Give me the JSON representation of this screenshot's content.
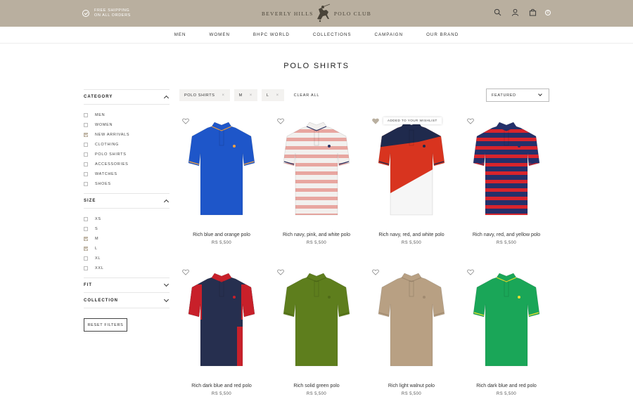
{
  "topbar": {
    "shipping_line1": "FREE SHIPPING",
    "shipping_line2": "ON ALL ORDERS",
    "logo_left": "BEVERLY HILLS",
    "logo_right": "POLO CLUB",
    "bag_count": "0",
    "bg_color": "#b9af9f"
  },
  "nav": {
    "items": [
      "MEN",
      "WOMEN",
      "BHPC WORLD",
      "COLLECTIONS",
      "CAMPAIGN",
      "OUR BRAND"
    ]
  },
  "page_title": "POLO SHIRTS",
  "sidebar": {
    "category": {
      "title": "CATEGORY",
      "options": [
        {
          "label": "MEN",
          "checked": false
        },
        {
          "label": "WOMEN",
          "checked": false
        },
        {
          "label": "NEW ARRIVALS",
          "checked": true
        },
        {
          "label": "CLOTHING",
          "checked": false
        },
        {
          "label": "POLO SHIRTS",
          "checked": false
        },
        {
          "label": "ACCESSORIES",
          "checked": false
        },
        {
          "label": "WATCHES",
          "checked": false
        },
        {
          "label": "SHOES",
          "checked": false
        }
      ]
    },
    "size": {
      "title": "SIZE",
      "options": [
        {
          "label": "XS",
          "checked": false
        },
        {
          "label": "S",
          "checked": false
        },
        {
          "label": "M",
          "checked": true
        },
        {
          "label": "L",
          "checked": true
        },
        {
          "label": "XL",
          "checked": false
        },
        {
          "label": "XXL",
          "checked": false
        }
      ]
    },
    "fit_title": "FIT",
    "collection_title": "COLLECTION",
    "reset_label": "RESET FILTERS"
  },
  "filters": {
    "chips": [
      "POLO SHIRTS",
      "M",
      "L"
    ],
    "clear_label": "CLEAR ALL",
    "sort_label": "FEATURED"
  },
  "wishlist_tooltip": "ADDED TO YOUR WISHLIST",
  "products": [
    {
      "name": "Rich blue and orange polo",
      "price": "RS 5,500",
      "style": "solid",
      "body": "#1e56c9",
      "collar": "#1e56c9",
      "trim": "#f0a040",
      "stripe": "",
      "wishlisted": false
    },
    {
      "name": "Rich navy, pink, and white polo",
      "price": "RS 5,500",
      "style": "stripes",
      "body": "#f2f0ee",
      "collar": "#f2f0ee",
      "trim": "#2a3160",
      "stripe": "#e8a6a0",
      "wishlisted": false
    },
    {
      "name": "Rich navy, red, and white polo",
      "price": "RS 5,500",
      "style": "diag",
      "body": "#f6f6f6",
      "collar": "#1f2a4d",
      "trim": "#1f2a4d",
      "stripe": "#d8341f",
      "wishlisted": true
    },
    {
      "name": "Rich navy, red, and yellow polo",
      "price": "RS 5,500",
      "style": "stripes",
      "body": "#24306a",
      "collar": "#24306a",
      "trim": "#24306a",
      "stripe": "#d8242c",
      "wishlisted": false
    },
    {
      "name": "Rich dark blue and red polo",
      "price": "RS 5,500",
      "style": "sleeves",
      "body": "#262f4f",
      "collar": "#c8202a",
      "trim": "#c8202a",
      "stripe": "#c8202a",
      "wishlisted": false
    },
    {
      "name": "Rich solid green polo",
      "price": "RS 5,500",
      "style": "solid",
      "body": "#5e7e1d",
      "collar": "#5e7e1d",
      "trim": "#4f6b17",
      "stripe": "",
      "wishlisted": false
    },
    {
      "name": "Rich light walnut polo",
      "price": "RS 5,500",
      "style": "solid",
      "body": "#b8a083",
      "collar": "#b8a083",
      "trim": "#a08a70",
      "stripe": "",
      "wishlisted": false
    },
    {
      "name": "Rich dark blue and red polo",
      "price": "RS 5,500",
      "style": "solid",
      "body": "#1aa658",
      "collar": "#1aa658",
      "trim": "#e8e030",
      "stripe": "",
      "wishlisted": false
    }
  ]
}
